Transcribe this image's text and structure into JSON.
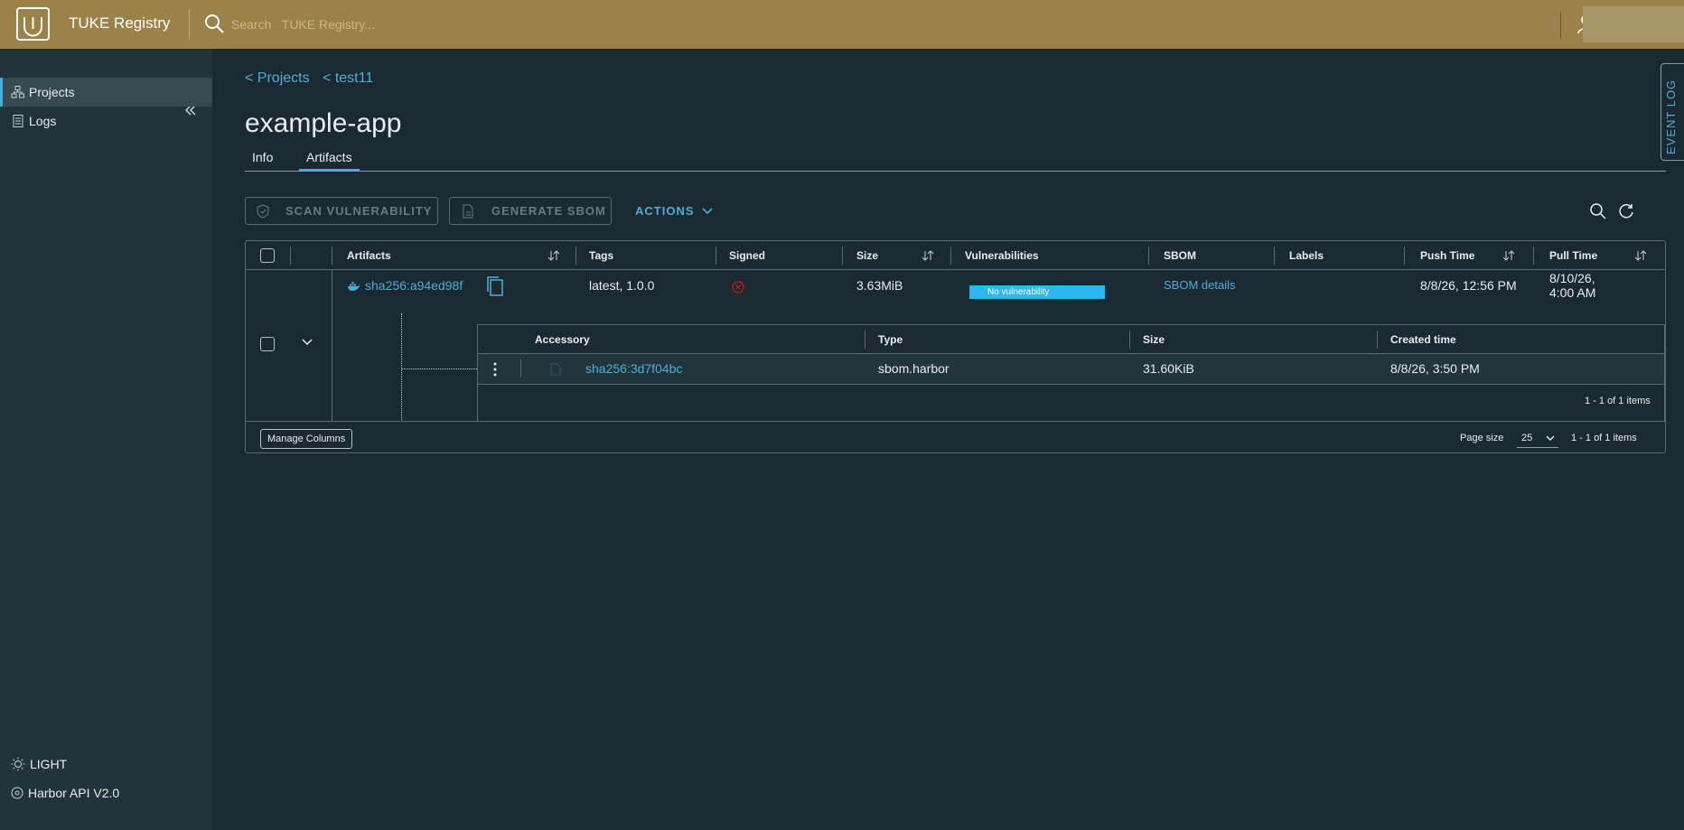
{
  "header": {
    "app_title": "TUKE Registry",
    "search_placeholder": "Search   TUKE Registry..."
  },
  "sidebar": {
    "items": [
      {
        "label": "Projects",
        "icon": "projects-icon",
        "active": true
      },
      {
        "label": "Logs",
        "icon": "logs-icon",
        "active": false
      }
    ],
    "theme_toggle": "LIGHT",
    "api_link": "Harbor API V2.0"
  },
  "breadcrumbs": [
    "< Projects",
    "< test11"
  ],
  "page_title": "example-app",
  "tabs": [
    {
      "label": "Info",
      "active": false
    },
    {
      "label": "Artifacts",
      "active": true
    }
  ],
  "event_log": "EVENT LOG",
  "toolbar": {
    "scan_label": "SCAN VULNERABILITY",
    "sbom_label": "GENERATE SBOM",
    "actions_label": "ACTIONS"
  },
  "grid": {
    "columns": [
      "Artifacts",
      "Tags",
      "Signed",
      "Size",
      "Vulnerabilities",
      "SBOM",
      "Labels",
      "Push Time",
      "Pull Time"
    ],
    "row": {
      "digest": "sha256:a94ed98f",
      "tags": "latest, 1.0.0",
      "size": "3.63MiB",
      "vulnerabilities": "No vulnerability",
      "sbom": "SBOM details",
      "push_time": "8/8/26, 12:56 PM",
      "pull_time_line1": "8/10/26,",
      "pull_time_line2": "4:00 AM"
    },
    "accessory": {
      "columns": [
        "Accessory",
        "Type",
        "Size",
        "Created time"
      ],
      "row": {
        "digest": "sha256:3d7f04bc",
        "type": "sbom.harbor",
        "size": "31.60KiB",
        "created": "8/8/26, 3:50 PM"
      },
      "count": "1 - 1 of 1 items"
    },
    "footer": {
      "manage_columns": "Manage Columns",
      "page_size_label": "Page size",
      "page_size": "25",
      "count": "1 - 1 of 1 items"
    }
  },
  "colors": {
    "header_bg": "#9a8248",
    "accent": "#49afd9",
    "vuln_bar": "#29b9f0",
    "unsigned": "#c92100"
  }
}
